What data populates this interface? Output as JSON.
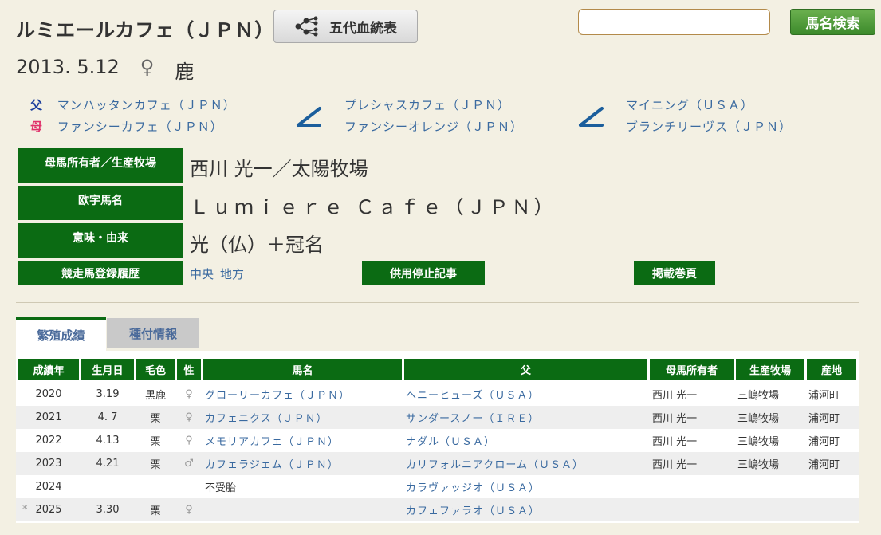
{
  "horse": {
    "name": "ルミエールカフェ（ＪＰＮ）",
    "birth_date": "2013. 5.12",
    "sex_symbol": "♀",
    "coat": "鹿"
  },
  "header": {
    "pedigree_button_label": "五代血統表",
    "search_placeholder": "",
    "search_button_label": "馬名検索"
  },
  "family": {
    "sire_tag": "父",
    "dam_tag": "母",
    "sire": "マンハッタンカフェ（ＪＰＮ）",
    "dam": "ファンシーカフェ（ＪＰＮ）",
    "dam_sire": "プレシャスカフェ（ＪＰＮ）",
    "dam_dam": "ファンシーオレンジ（ＪＰＮ）",
    "dam_dam_sire": "マイニング（ＵＳＡ）",
    "dam_dam_dam": "ブランチリーヴス（ＪＰＮ）"
  },
  "info": {
    "owner_label": "母馬所有者／生産牧場",
    "owner_value": "西川 光一／太陽牧場",
    "roman_label": "欧字馬名",
    "roman_value": "Ｌｕｍｉｅｒｅ Ｃａｆｅ（ＪＰＮ）",
    "meaning_label": "意味・由来",
    "meaning_value": "光（仏）＋冠名",
    "registry_label": "競走馬登録履歴",
    "registry_link_central": "中央",
    "registry_link_local": "地方",
    "stop_button": "供用停止記事",
    "volume_button": "掲載巻頁"
  },
  "tabs": {
    "active": "繁殖成績",
    "inactive": "種付情報"
  },
  "table": {
    "headers": [
      "成績年",
      "生月日",
      "毛色",
      "性",
      "馬名",
      "父",
      "母馬所有者",
      "生産牧場",
      "産地"
    ],
    "rows": [
      {
        "mark": "",
        "year": "2020",
        "date": "3.19",
        "color": "黒鹿",
        "sex": "♀",
        "name": "グローリーカフェ（ＪＰＮ）",
        "sire": "ヘニーヒューズ（ＵＳＡ）",
        "owner": "西川 光一",
        "farm": "三嶋牧場",
        "place": "浦河町"
      },
      {
        "mark": "",
        "year": "2021",
        "date": "4. 7",
        "color": "栗",
        "sex": "♀",
        "name": "カフェニクス（ＪＰＮ）",
        "sire": "サンダースノー（ＩＲＥ）",
        "owner": "西川 光一",
        "farm": "三嶋牧場",
        "place": "浦河町"
      },
      {
        "mark": "",
        "year": "2022",
        "date": "4.13",
        "color": "栗",
        "sex": "♀",
        "name": "メモリアカフェ（ＪＰＮ）",
        "sire": "ナダル（ＵＳＡ）",
        "owner": "西川 光一",
        "farm": "三嶋牧場",
        "place": "浦河町"
      },
      {
        "mark": "",
        "year": "2023",
        "date": "4.21",
        "color": "栗",
        "sex": "♂",
        "name": "カフェラジェム（ＪＰＮ）",
        "sire": "カリフォルニアクローム（ＵＳＡ）",
        "owner": "西川 光一",
        "farm": "三嶋牧場",
        "place": "浦河町"
      },
      {
        "mark": "",
        "year": "2024",
        "date": "",
        "color": "",
        "sex": "",
        "name": "不受胎",
        "sire": "カラヴァッジオ（ＵＳＡ）",
        "owner": "",
        "farm": "",
        "place": ""
      },
      {
        "mark": "*",
        "year": "2025",
        "date": "3.30",
        "color": "栗",
        "sex": "♀",
        "name": "",
        "sire": "カフェファラオ（ＵＳＡ）",
        "owner": "",
        "farm": "",
        "place": ""
      }
    ]
  },
  "colors": {
    "accent_green": "#0b6b13",
    "link_blue": "#3a6aa0",
    "background": "#f3f0e3"
  }
}
